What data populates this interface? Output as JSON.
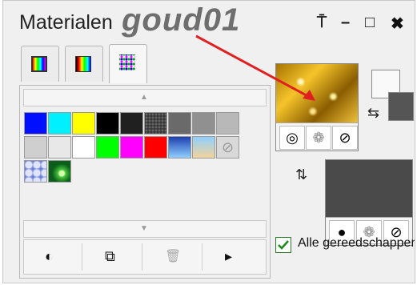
{
  "panel": {
    "title": "Materialen",
    "overlay_title": "goud01",
    "controls": {
      "pin": "⍑",
      "minimize": "–",
      "maximize": "□",
      "close": "✖"
    }
  },
  "tabs": [
    {
      "name": "frame",
      "active": false
    },
    {
      "name": "gradient",
      "active": false
    },
    {
      "name": "swatches",
      "active": true
    }
  ],
  "swatches": {
    "row1": [
      "#0010ff",
      "#00f0ff",
      "#ffff00",
      "#000000",
      "#202020",
      "#383838",
      "#6a6a6a",
      "#909090",
      "#b8b8b8"
    ],
    "row2": [
      "#cfcfcf",
      "#e8e8e8",
      "#ffffff",
      "#00ff00",
      "#ff00ff",
      "#ff0000",
      "#2f5bd0",
      "#8fd0ff",
      "none"
    ],
    "row3": [
      "pattern-blue",
      "pattern-green"
    ]
  },
  "toolbar": {
    "buttons": [
      {
        "name": "palette-button",
        "glyph": "◐"
      },
      {
        "name": "add-swatch-button",
        "glyph": "⧉"
      },
      {
        "name": "delete-swatch-button",
        "glyph": "🗑"
      },
      {
        "name": "more-button",
        "glyph": "▸"
      }
    ]
  },
  "properties": {
    "foreground_label": "",
    "background_color": "#555555",
    "foreground_color": "#c89a16"
  },
  "checkbox": {
    "label": "Alle gereedschappen",
    "checked": true
  }
}
